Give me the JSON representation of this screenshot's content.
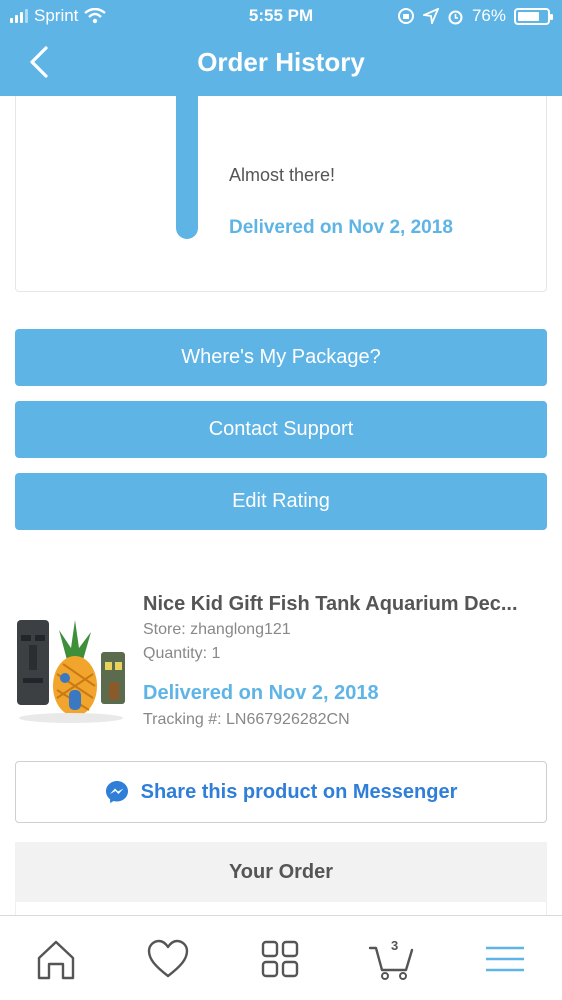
{
  "status_bar": {
    "carrier": "Sprint",
    "time": "5:55 PM",
    "battery": "76%",
    "battery_level": 0.76
  },
  "nav": {
    "title": "Order History"
  },
  "tracking": {
    "message": "Almost there!",
    "delivered": "Delivered on Nov 2, 2018"
  },
  "actions": {
    "where_package": "Where's My Package?",
    "contact_support": "Contact Support",
    "edit_rating": "Edit Rating"
  },
  "product": {
    "title": "Nice Kid Gift Fish Tank Aquarium Dec...",
    "store": "Store: zhanglong121",
    "quantity": "Quantity: 1",
    "delivered": "Delivered on Nov 2, 2018",
    "tracking": "Tracking #: LN667926282CN"
  },
  "share": {
    "label": "Share this product on Messenger"
  },
  "your_order": {
    "title": "Your Order"
  },
  "tab_bar": {
    "cart_count": "3"
  },
  "colors": {
    "accent": "#5fb4e6",
    "messenger_blue": "#2f7fd9"
  }
}
